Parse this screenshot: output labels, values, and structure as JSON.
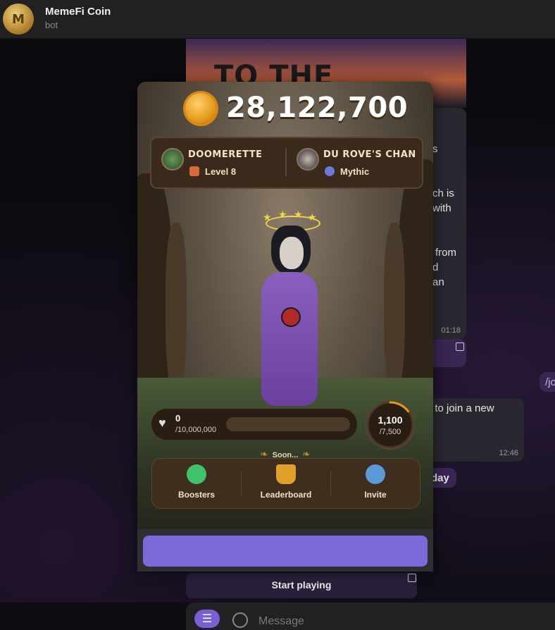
{
  "chat": {
    "title": "MemeFi Coin",
    "subtitle": "bot",
    "avatar_glyph": "M",
    "banner_text": "TO THE MOON!!",
    "bubble_fragments": [
      "s",
      "ch is",
      "with",
      "from",
      "d",
      "an"
    ],
    "time_1": "01:18",
    "join_fragment": "t to join a new",
    "time_2": "12:46",
    "day_fragment": "day",
    "cmd_fragment": "/jo",
    "start_playing": "Start playing",
    "message_placeholder": "Message"
  },
  "game": {
    "coins": "28,122,700",
    "player1": {
      "name": "DOOMERETTE",
      "level": "Level 8"
    },
    "player2": {
      "name": "DU ROVE'S CHAN",
      "rank": "Mythic"
    },
    "energy": {
      "value": "0",
      "max": "/10,000,000",
      "fill_fraction": 0
    },
    "ring": {
      "value": "1,100",
      "max": "/7,500",
      "fraction": 0.147
    },
    "soon_label": "Soon...",
    "nav": [
      {
        "label": "Boosters",
        "icon": "boosters-icon"
      },
      {
        "label": "Leaderboard",
        "icon": "trophy-icon"
      },
      {
        "label": "Invite",
        "icon": "invite-icon"
      }
    ]
  },
  "colors": {
    "accent": "#7b6ad9",
    "coin": "#e59a1a",
    "panel": "#3f2e1e"
  }
}
